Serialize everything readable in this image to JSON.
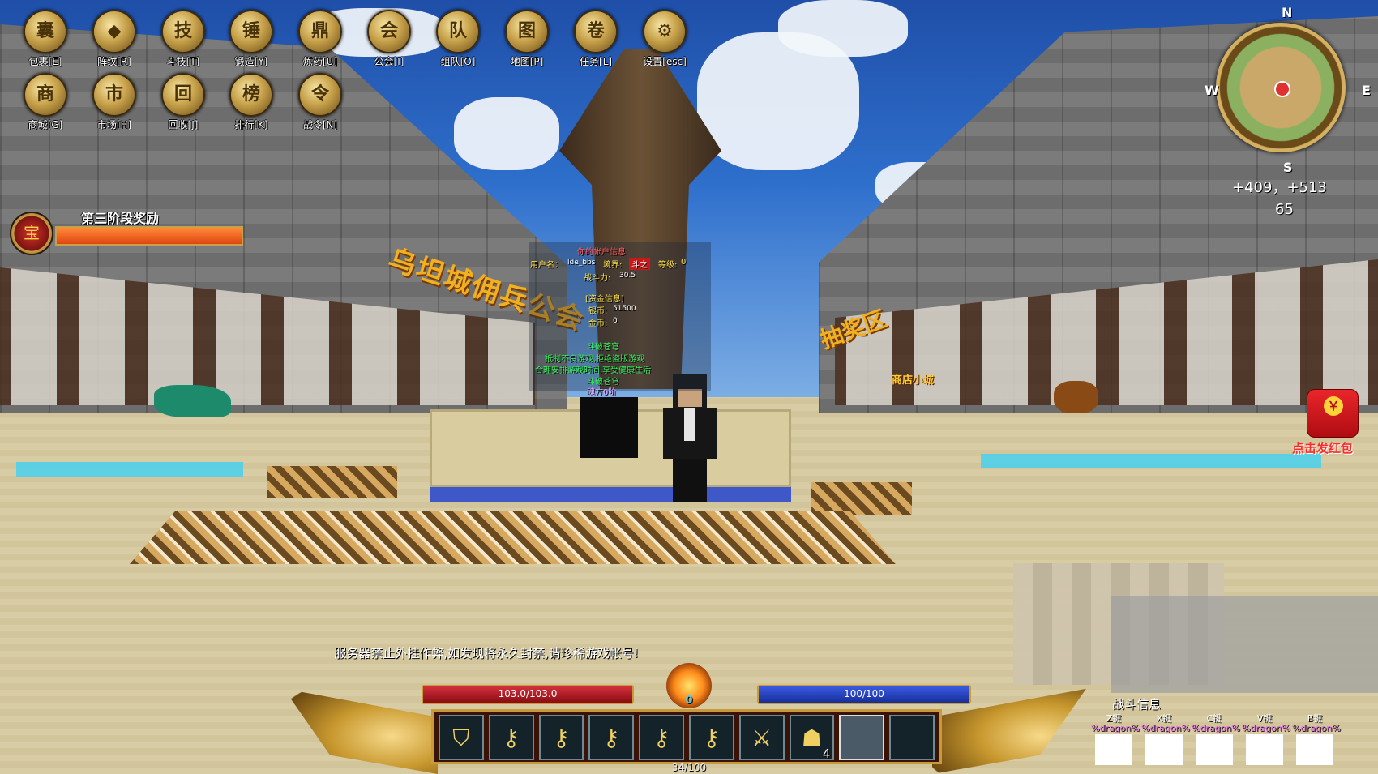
{
  "menu": {
    "row1": [
      {
        "label": "包裹[E]",
        "icon": "backpack-icon",
        "glyph": "囊"
      },
      {
        "label": "阵纹[R]",
        "icon": "formation-icon",
        "glyph": "◆"
      },
      {
        "label": "斗技[T]",
        "icon": "skill-icon",
        "glyph": "技"
      },
      {
        "label": "锻造[Y]",
        "icon": "forge-icon",
        "glyph": "锤"
      },
      {
        "label": "炼药[U]",
        "icon": "alchemy-icon",
        "glyph": "鼎"
      },
      {
        "label": "公会[I]",
        "icon": "guild-icon",
        "glyph": "会"
      },
      {
        "label": "组队[O]",
        "icon": "team-icon",
        "glyph": "队"
      },
      {
        "label": "地图[P]",
        "icon": "map-icon",
        "glyph": "图"
      },
      {
        "label": "任务[L]",
        "icon": "quest-icon",
        "glyph": "卷"
      },
      {
        "label": "设置[esc]",
        "icon": "gear-icon",
        "glyph": "⚙"
      }
    ],
    "row2": [
      {
        "label": "商城[G]",
        "icon": "shop-icon",
        "glyph": "商"
      },
      {
        "label": "市场[H]",
        "icon": "market-icon",
        "glyph": "市"
      },
      {
        "label": "回收[J]",
        "icon": "recycle-icon",
        "glyph": "回"
      },
      {
        "label": "排行[K]",
        "icon": "ranking-icon",
        "glyph": "榜"
      },
      {
        "label": "战令[N]",
        "icon": "battle-pass-icon",
        "glyph": "令"
      }
    ]
  },
  "stage_reward": {
    "title": "第三阶段奖励",
    "icon": "treasure-chest-icon",
    "progress": 1.0
  },
  "board": {
    "account_header": "你的帐户信息",
    "user_label": "用户名：",
    "user_value": "lde_bbs",
    "realm_label": "境界:",
    "realm_value": "斗之",
    "level_label": "等级:",
    "level_value": "0",
    "power_label": "战斗力:",
    "power_value": "30.5",
    "funds_header": "[资金信息]",
    "silver_label": "银币:",
    "silver_value": "51500",
    "gold_label": "金币:",
    "gold_value": "0",
    "server_title": "斗破苍穹",
    "health_line1": "抵制不良游戏,拒绝盗版游戏",
    "health_line2": "合理安排游戏时间,享受健康生活",
    "footer_title": "斗破苍穹",
    "footer_line": "魂方0阶"
  },
  "signs": {
    "guild_banner": "乌坦城佣兵公会",
    "lottery_banner": "抽奖区",
    "shop_sign": "商店小城"
  },
  "minimap": {
    "north": "N",
    "south": "S",
    "east": "E",
    "west": "W",
    "coords": "+409，+513",
    "height": "65"
  },
  "red_envelope": {
    "label": "点击发红包",
    "glyph": "￥"
  },
  "announcement": "服务器禁止外挂作弊,如发现将永久封禁,请珍稀游戏帐号!",
  "status": {
    "hp_text": "103.0/103.0",
    "hp_fraction": 1.0,
    "mp_text": "100/100",
    "mp_fraction": 1.0,
    "flame_value": "0",
    "xp_text": "34/100"
  },
  "hotbar": [
    {
      "name": "shield-slot",
      "glyph": "⛉",
      "qty": ""
    },
    {
      "name": "golden-key-slot",
      "glyph": "⚷",
      "qty": ""
    },
    {
      "name": "yellow-key-slot",
      "glyph": "⚷",
      "qty": ""
    },
    {
      "name": "blue-key-slot",
      "glyph": "⚷",
      "qty": ""
    },
    {
      "name": "gold-key-slot",
      "glyph": "⚷",
      "qty": ""
    },
    {
      "name": "large-gold-key-slot",
      "glyph": "⚷",
      "qty": ""
    },
    {
      "name": "sword-slot",
      "glyph": "⚔",
      "qty": ""
    },
    {
      "name": "mask-slot",
      "glyph": "☗",
      "qty": "4"
    },
    {
      "name": "empty-slot-selected",
      "glyph": "",
      "qty": ""
    },
    {
      "name": "empty-slot",
      "glyph": "",
      "qty": ""
    }
  ],
  "combat": {
    "title": "战斗信息",
    "skills": [
      {
        "key": "Z键",
        "name": "%dragon%"
      },
      {
        "key": "X键",
        "name": "%dragon%"
      },
      {
        "key": "C键",
        "name": "%dragon%"
      },
      {
        "key": "V键",
        "name": "%dragon%"
      },
      {
        "key": "B键",
        "name": "%dragon%"
      }
    ]
  }
}
